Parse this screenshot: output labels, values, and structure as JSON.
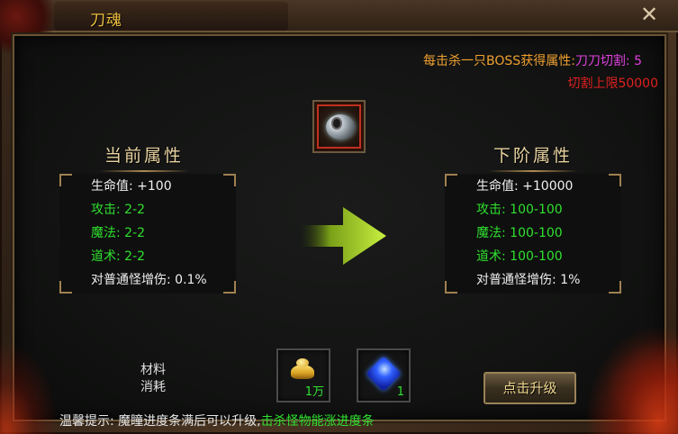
{
  "window": {
    "title": "刀魂",
    "close_symbol": "✕"
  },
  "boss": {
    "label": "每击杀一只BOSS获得属性:",
    "value": "刀刀切割: 5",
    "limit": "切割上限50000"
  },
  "current": {
    "title": "当前属性",
    "rows": [
      {
        "label": "生命值: +100",
        "color": "#f0f0f0"
      },
      {
        "label": "攻击: 2-2",
        "color": "#30e030"
      },
      {
        "label": "魔法: 2-2",
        "color": "#30e030"
      },
      {
        "label": "道术: 2-2",
        "color": "#30e030"
      },
      {
        "label": "对普通怪增伤: 0.1%",
        "color": "#f0f0f0"
      }
    ]
  },
  "next": {
    "title": "下阶属性",
    "rows": [
      {
        "label": "生命值: +10000",
        "color": "#f0f0f0"
      },
      {
        "label": "攻击: 100-100",
        "color": "#30e030"
      },
      {
        "label": "魔法: 100-100",
        "color": "#30e030"
      },
      {
        "label": "道术: 100-100",
        "color": "#30e030"
      },
      {
        "label": "对普通怪增伤: 1%",
        "color": "#f0f0f0"
      }
    ]
  },
  "materials": {
    "label_line1": "材料",
    "label_line2": "消耗",
    "items": [
      {
        "icon": "gold-ingot-icon",
        "count": "1万"
      },
      {
        "icon": "blue-gem-icon",
        "count": "1"
      }
    ]
  },
  "upgrade_button": "点击升级",
  "tip": {
    "prefix": "温馨提示: 魔瞳进度条满后可以升级,",
    "highlight": "击杀怪物能涨进度条"
  },
  "colors": {
    "gold": "#f0c040",
    "orange": "#f0a030",
    "magenta": "#e040e0",
    "red": "#e02020",
    "green": "#30e030"
  }
}
